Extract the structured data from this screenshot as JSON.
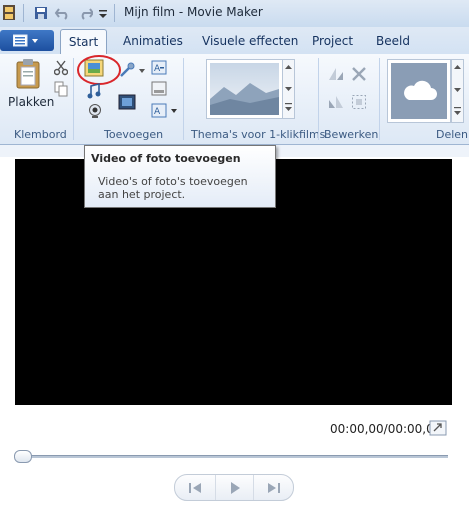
{
  "window": {
    "title": "Mijn film - Movie Maker"
  },
  "quick_access": {
    "icons": [
      "movie-maker-app-icon",
      "save-icon",
      "undo-icon",
      "redo-icon",
      "customize-dropdown-icon"
    ]
  },
  "tabs": [
    "Start",
    "Animaties",
    "Visuele effecten",
    "Project",
    "Beeld"
  ],
  "ribbon": {
    "groups": {
      "clipboard": {
        "label": "Klembord",
        "paste_label": "Plakken"
      },
      "add": {
        "label": "Toevoegen"
      },
      "themes": {
        "label": "Thema's voor 1-klikfilms"
      },
      "edit": {
        "label": "Bewerken"
      },
      "share": {
        "label": "Delen"
      }
    }
  },
  "tooltip": {
    "title": "Video of foto toevoegen",
    "text": "Video's of foto's toevoegen aan het project."
  },
  "preview": {
    "timecode": "00:00,00/00:00,00"
  },
  "colors": {
    "accent": "#1d4f9f",
    "highlight_circle": "#d9262b",
    "preview_bg": "#000000"
  }
}
